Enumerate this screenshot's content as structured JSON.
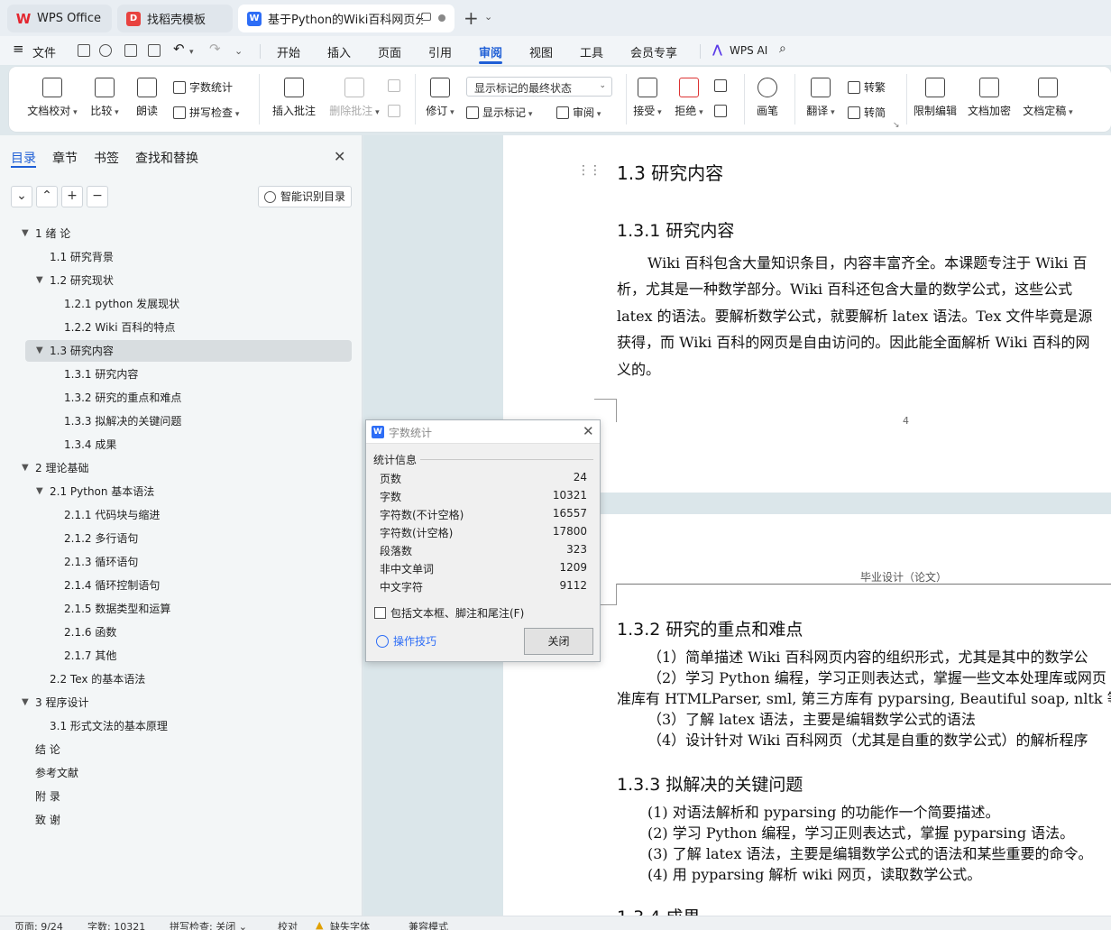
{
  "tabs": [
    {
      "label": "WPS Office"
    },
    {
      "label": "找稻壳模板"
    },
    {
      "label": "基于Python的Wiki百科网页分"
    }
  ],
  "menubar": {
    "file": "文件",
    "items": [
      "开始",
      "插入",
      "页面",
      "引用",
      "审阅",
      "视图",
      "工具",
      "会员专享"
    ],
    "active": "审阅",
    "wps_ai": "WPS AI"
  },
  "ribbon": {
    "doc_check": "文档校对",
    "compare": "比较",
    "read_aloud": "朗读",
    "word_count": "字数统计",
    "spell_check": "拼写检查",
    "insert_comment": "插入批注",
    "delete_comment": "删除批注",
    "track_changes": "修订",
    "markup_state": "显示标记的最终状态",
    "show_markup": "显示标记",
    "review": "审阅",
    "accept": "接受",
    "reject": "拒绝",
    "pen": "画笔",
    "translate": "翻译",
    "to_traditional": "转繁",
    "to_simplified": "转简",
    "restrict_edit": "限制编辑",
    "encrypt": "文档加密",
    "finalize": "文档定稿"
  },
  "nav": {
    "tabs": [
      "目录",
      "章节",
      "书签",
      "查找和替换"
    ],
    "smart_toc": "智能识别目录",
    "toc": [
      {
        "label": "1 绪 论",
        "level": 0,
        "expanded": true
      },
      {
        "label": "1.1 研究背景",
        "level": 1
      },
      {
        "label": "1.2 研究现状",
        "level": 1,
        "expanded": true
      },
      {
        "label": "1.2.1 python 发展现状",
        "level": 2
      },
      {
        "label": "1.2.2 Wiki 百科的特点",
        "level": 2
      },
      {
        "label": "1.3 研究内容",
        "level": 1,
        "expanded": true,
        "selected": true
      },
      {
        "label": "1.3.1 研究内容",
        "level": 2
      },
      {
        "label": "1.3.2 研究的重点和难点",
        "level": 2
      },
      {
        "label": "1.3.3 拟解决的关键问题",
        "level": 2
      },
      {
        "label": "1.3.4 成果",
        "level": 2
      },
      {
        "label": "2 理论基础",
        "level": 0,
        "expanded": true
      },
      {
        "label": "2.1 Python 基本语法",
        "level": 1,
        "expanded": true
      },
      {
        "label": "2.1.1 代码块与缩进",
        "level": 2
      },
      {
        "label": "2.1.2 多行语句",
        "level": 2
      },
      {
        "label": "2.1.3 循环语句",
        "level": 2
      },
      {
        "label": "2.1.4 循环控制语句",
        "level": 2
      },
      {
        "label": "2.1.5 数据类型和运算",
        "level": 2
      },
      {
        "label": "2.1.6 函数",
        "level": 2
      },
      {
        "label": "2.1.7 其他",
        "level": 2
      },
      {
        "label": "2.2 Tex 的基本语法",
        "level": 1
      },
      {
        "label": "3 程序设计",
        "level": 0,
        "expanded": true
      },
      {
        "label": "3.1 形式文法的基本原理",
        "level": 1
      },
      {
        "label": "结 论",
        "level": 0
      },
      {
        "label": "参考文献",
        "level": 0
      },
      {
        "label": "附 录",
        "level": 0
      },
      {
        "label": "致 谢",
        "level": 0
      }
    ]
  },
  "document": {
    "h2_1_3": "1.3  研究内容",
    "h3_1_3_1": "1.3.1 研究内容",
    "para1": [
      "Wiki 百科包含大量知识条目，内容丰富齐全。本课题专注于 Wiki 百",
      "析，尤其是一种数学部分。Wiki 百科还包含大量的数学公式，这些公式",
      "latex 的语法。要解析数学公式，就要解析 latex 语法。Tex 文件毕竟是源",
      "获得，而 Wiki 百科的网页是自由访问的。因此能全面解析 Wiki 百科的网",
      "义的。"
    ],
    "page_number": "4",
    "header_text": "毕业设计（论文）",
    "h3_1_3_2": "1.3.2 研究的重点和难点",
    "list_1_3_2": [
      "（1）简单描述 Wiki 百科网页内容的组织形式，尤其是其中的数学公",
      "（2）学习 Python 编程，学习正则表达式，掌握一些文本处理库或网页",
      "准库有 HTMLParser, sml, 第三方库有 pyparsing, Beautiful soap, nltk 等）",
      "（3）了解 latex 语法，主要是编辑数学公式的语法",
      "（4）设计针对 Wiki 百科网页（尤其是自重的数学公式）的解析程序"
    ],
    "h3_1_3_3": "1.3.3 拟解决的关键问题",
    "list_1_3_3": [
      "(1) 对语法解析和 pyparsing 的功能作一个简要描述。",
      "(2) 学习 Python 编程，学习正则表达式，掌握 pyparsing 语法。",
      "(3) 了解 latex 语法，主要是编辑数学公式的语法和某些重要的命令。",
      "(4) 用 pyparsing 解析 wiki 网页，读取数学公式。"
    ],
    "h3_1_3_4": "1.3.4 成果"
  },
  "word_count_dialog": {
    "title": "字数统计",
    "group": "统计信息",
    "rows": [
      {
        "label": "页数",
        "value": "24"
      },
      {
        "label": "字数",
        "value": "10321"
      },
      {
        "label": "字符数(不计空格)",
        "value": "16557"
      },
      {
        "label": "字符数(计空格)",
        "value": "17800"
      },
      {
        "label": "段落数",
        "value": "323"
      },
      {
        "label": "非中文单词",
        "value": "1209"
      },
      {
        "label": "中文字符",
        "value": "9112"
      }
    ],
    "include_label": "包括文本框、脚注和尾注(F)",
    "tips": "操作技巧",
    "close": "关闭"
  },
  "status": {
    "page": "页面: 9/24",
    "words": "字数: 10321",
    "spell": "拼写检查: 关闭",
    "proof": "校对",
    "missing_font": "缺失字体",
    "compat": "兼容模式"
  }
}
